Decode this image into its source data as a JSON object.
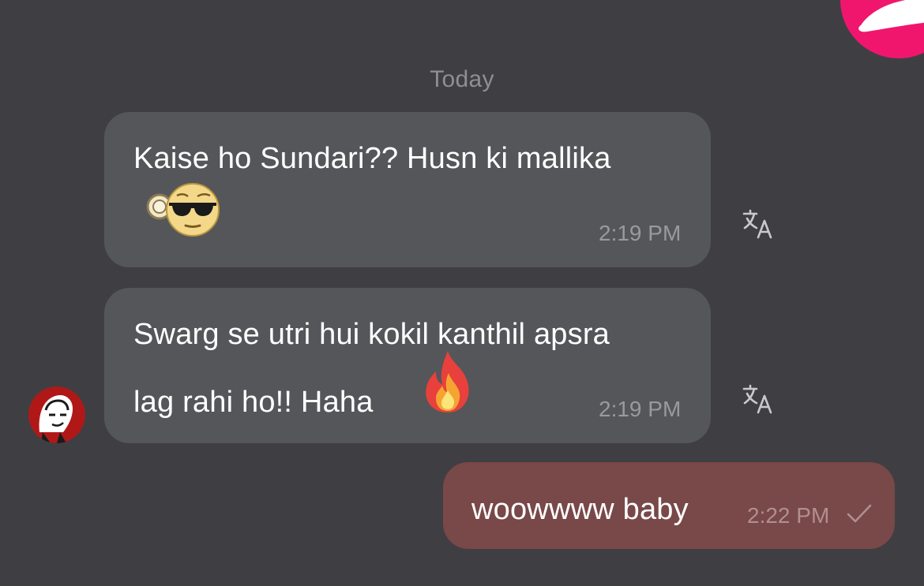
{
  "date_separator": "Today",
  "messages": [
    {
      "direction": "incoming",
      "lines": [
        "Kaise ho Sundari?? Husn ki mallika"
      ],
      "emoji": "monocle-sunglasses-face",
      "time": "2:19 PM"
    },
    {
      "direction": "incoming",
      "lines": [
        "Swarg se utri hui kokil kanthil apsra",
        "lag rahi ho!! Haha"
      ],
      "emoji": "fire",
      "time": "2:19 PM"
    },
    {
      "direction": "outgoing",
      "lines": [
        "woowwww baby"
      ],
      "time": "2:22 PM",
      "status_icon": "check-icon"
    }
  ],
  "icons": {
    "translate": "translate-icon",
    "avatar": "user-avatar",
    "corner": "app-logo"
  },
  "colors": {
    "background": "#3f3f43",
    "incoming_bubble": "#555659",
    "outgoing_bubble": "#794848",
    "timestamp": "#9a9a9d",
    "date_separator": "#8f8f93",
    "logo_accent": "#f0166e"
  }
}
